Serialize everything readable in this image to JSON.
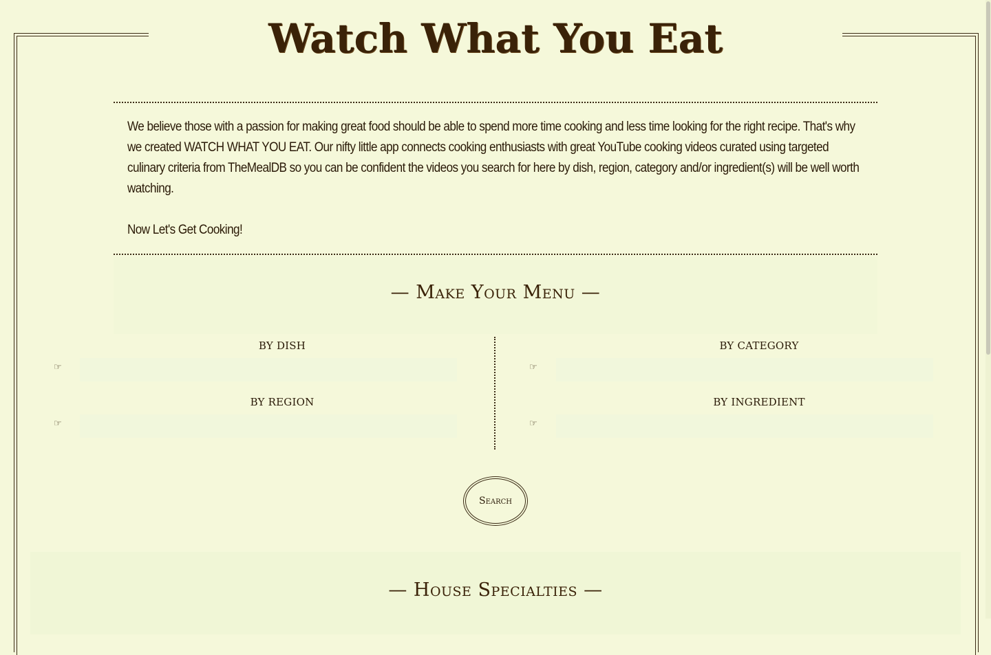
{
  "header": {
    "title": "Watch What You Eat"
  },
  "intro": {
    "paragraph": "We believe those with a passion for making great food should be able to spend more time cooking and less time looking for the right recipe. That's why we created WATCH WHAT YOU EAT. Our nifty little app connects cooking enthusiasts with great YouTube cooking videos curated using targeted culinary criteria from TheMealDB so you can be confident the videos you search for here by dish, region, category and/or ingredient(s) will be well worth watching.",
    "cta": "Now Let's Get Cooking!"
  },
  "menu": {
    "heading": "— Make Your Menu —",
    "fields": {
      "dish": {
        "label": "BY DISH",
        "value": "",
        "icon": "pointing-hand-icon"
      },
      "category": {
        "label": "BY CATEGORY",
        "value": "",
        "icon": "pointing-hand-icon"
      },
      "region": {
        "label": "BY REGION",
        "value": "",
        "icon": "pointing-hand-icon"
      },
      "ingredient": {
        "label": "BY INGREDIENT",
        "value": "",
        "icon": "pointing-hand-icon"
      }
    },
    "search_label": "Search"
  },
  "specialties": {
    "heading": "— House Specialties —"
  },
  "colors": {
    "background": "#f5f8da",
    "text": "#2b1a06",
    "input_bg": "#f1f7dc"
  }
}
